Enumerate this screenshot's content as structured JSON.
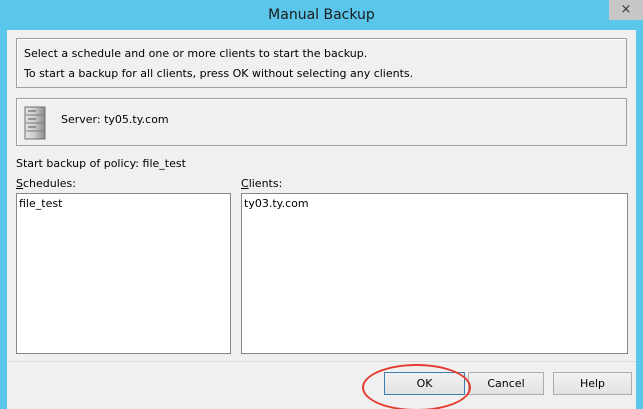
{
  "window": {
    "title": "Manual Backup",
    "close_glyph": "×"
  },
  "info": {
    "line1": "Select a schedule and one or more clients to start the backup.",
    "line2": "To start a backup for all clients, press OK without selecting any clients."
  },
  "server": {
    "icon": "server-icon",
    "text": "Server: ty05.ty.com"
  },
  "policy": {
    "label": "Start backup of policy:",
    "name": "file_test"
  },
  "schedules": {
    "label_first": "S",
    "label_rest": "chedules:",
    "items": [
      "file_test"
    ]
  },
  "clients": {
    "label_first": "C",
    "label_rest": "lients:",
    "items": [
      "ty03.ty.com"
    ]
  },
  "buttons": {
    "ok": "OK",
    "cancel": "Cancel",
    "help": "Help"
  },
  "colors": {
    "title_bar": "#5ac6ec",
    "dialog_bg": "#f0f0f0",
    "annotation_ring": "#e53a2e"
  }
}
